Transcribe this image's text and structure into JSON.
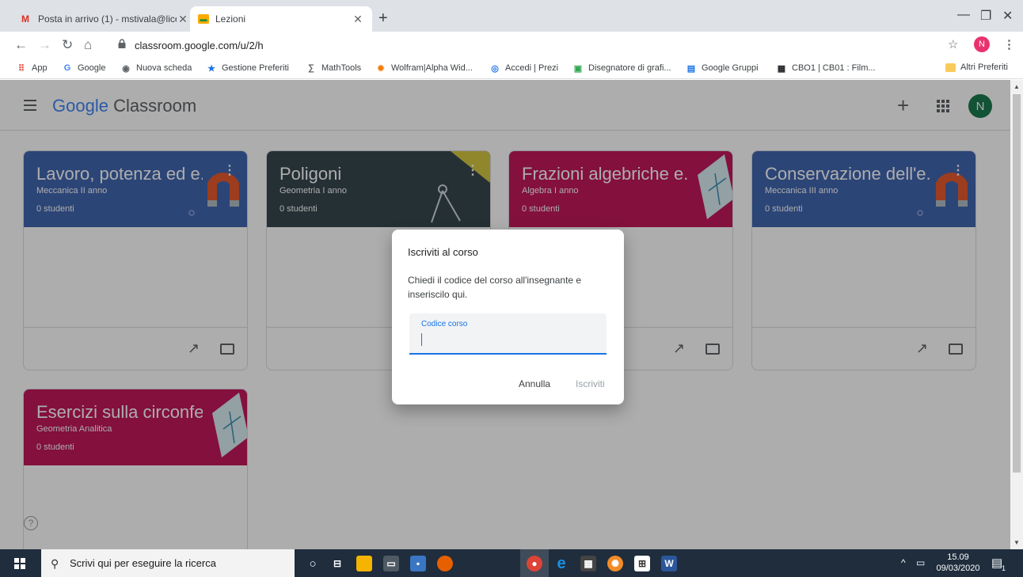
{
  "browser": {
    "tabs": [
      {
        "title": "Posta in arrivo (1) - mstivala@lice",
        "icon": "gmail-icon"
      },
      {
        "title": "Lezioni",
        "icon": "classroom-icon"
      }
    ],
    "url": "classroom.google.com/u/2/h",
    "profile_initial": "N",
    "bookmarks": [
      "App",
      "Google",
      "Nuova scheda",
      "Gestione Preferiti",
      "MathTools",
      "Wolfram|Alpha Wid...",
      "Accedi | Prezi",
      "Disegnatore di grafi...",
      "Google Gruppi",
      "CBO1 | CB01 : Film...",
      "Altri Preferiti"
    ]
  },
  "app": {
    "logo_google": "Google",
    "logo_classroom": "Classroom",
    "avatar_initial": "N",
    "colors": {
      "blue": "#4266b0",
      "dark": "#37474f",
      "pink": "#c2185b"
    }
  },
  "courses": [
    {
      "title": "Lavoro, potenza ed e...",
      "section": "Meccanica II anno",
      "students": "0 studenti"
    },
    {
      "title": "Poligoni",
      "section": "Geometria I anno",
      "students": "0 studenti"
    },
    {
      "title": "Frazioni algebriche e...",
      "section": "Algebra I anno",
      "students": "0 studenti"
    },
    {
      "title": "Conservazione dell'e...",
      "section": "Meccanica III anno",
      "students": "0 studenti"
    },
    {
      "title": "Esercizi sulla circonfe...",
      "section": "Geometria Analitica",
      "students": "0 studenti"
    }
  ],
  "dialog": {
    "title": "Iscriviti al corso",
    "text": "Chiedi il codice del corso all'insegnante e inseriscilo qui.",
    "field_label": "Codice corso",
    "field_value": "",
    "cancel": "Annulla",
    "join": "Iscriviti"
  },
  "taskbar": {
    "search_placeholder": "Scrivi qui per eseguire la ricerca",
    "time": "15.09",
    "date": "09/03/2020",
    "notification_count": "1"
  }
}
